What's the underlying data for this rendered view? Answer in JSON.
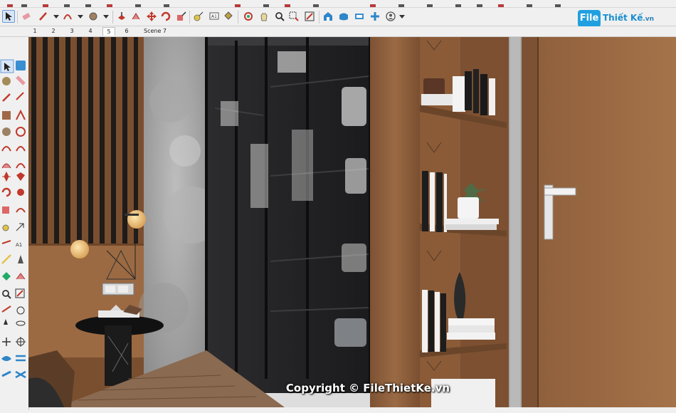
{
  "scene_tabs": [
    "1",
    "2",
    "3",
    "4",
    "5",
    "6",
    "Scene 7"
  ],
  "selected_tab": "5",
  "logo": {
    "badge": "File",
    "text": "Thiết Kế",
    "suffix": ".vn"
  },
  "watermark": "Copyright © FileThietKe.vn",
  "colors": {
    "toolbar_bg": "#f0f0f0",
    "accent": "#21a0e0",
    "wood": "#8b5e3c"
  }
}
